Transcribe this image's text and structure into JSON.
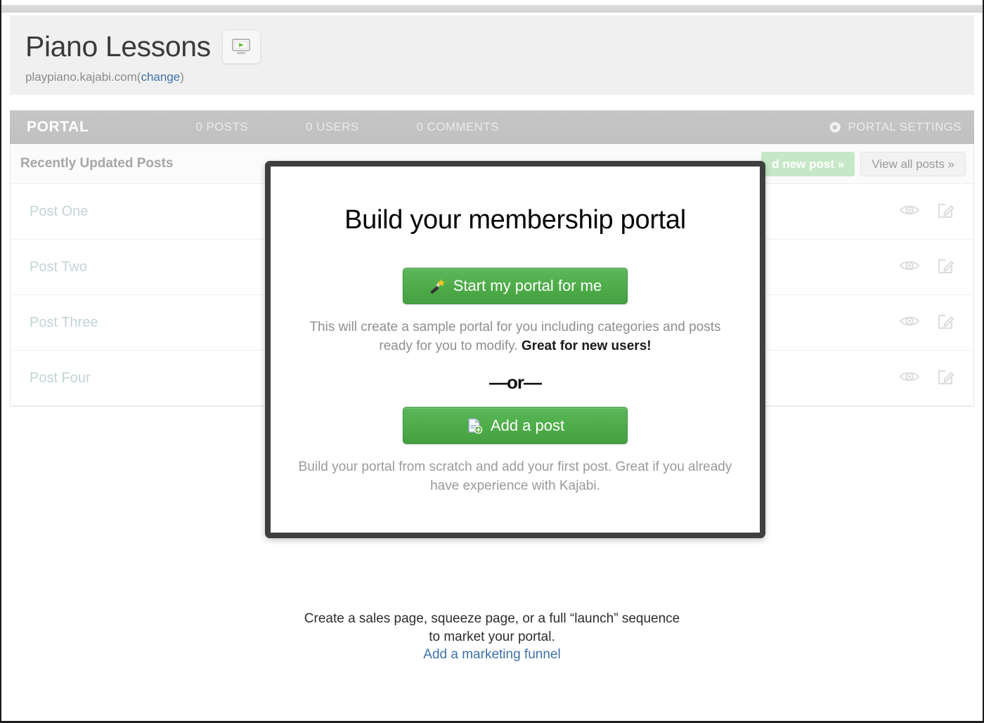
{
  "header": {
    "title": "Piano Lessons",
    "badge_icon": "video-screen-icon",
    "domain": "playpiano.kajabi.com",
    "paren_open": "(",
    "change_link": "change",
    "paren_close": ")"
  },
  "portal_bar": {
    "label": "PORTAL",
    "stats": [
      "0 POSTS",
      "0 USERS",
      "0 COMMENTS"
    ],
    "settings_label": "PORTAL SETTINGS",
    "settings_icon": "gear-icon"
  },
  "posts_panel": {
    "heading": "Recently Updated Posts",
    "add_post_button": "d new post »",
    "view_all_button": "View all posts »",
    "rows": [
      {
        "name": "Post One",
        "preview_icon": "eye-icon",
        "edit_icon": "edit-pencil-icon"
      },
      {
        "name": "Post Two",
        "preview_icon": "eye-icon",
        "edit_icon": "edit-pencil-icon"
      },
      {
        "name": "Post Three",
        "preview_icon": "eye-icon",
        "edit_icon": "edit-pencil-icon"
      },
      {
        "name": "Post Four",
        "preview_icon": "eye-icon",
        "edit_icon": "edit-pencil-icon"
      }
    ]
  },
  "modal": {
    "title": "Build your membership portal",
    "primary_button": {
      "label": "Start my portal for me",
      "icon": "magic-wand-icon"
    },
    "primary_desc_plain": "This will create a sample portal for you including categories and posts ready for you to modify. ",
    "primary_desc_bold": "Great for new users!",
    "separator": "—or—",
    "secondary_button": {
      "label": "Add a post",
      "icon": "new-document-icon"
    },
    "secondary_desc": "Build your portal from scratch and add your first post. Great if you already have experience with Kajabi."
  },
  "footer": {
    "line1": "Create a sales page, squeeze page, or a full “launch” sequence",
    "line2": "to market your portal.",
    "link": "Add a marketing funnel"
  },
  "colors": {
    "green_button": "#4fad4a",
    "link_blue": "#3d71a8",
    "portal_bar_gray": "#c2c2c2",
    "post_name": "#c2d4d6",
    "modal_border": "#3f3f3f"
  }
}
